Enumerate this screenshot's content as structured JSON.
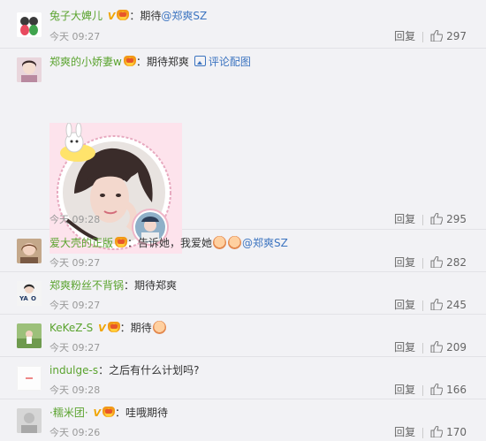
{
  "comments": [
    {
      "username": "兔子大婢儿",
      "vip": "V",
      "text": "期待",
      "mention": "@郑爽SZ",
      "time": "今天 09:27",
      "reply": "回复",
      "likes": "297"
    },
    {
      "username": "郑爽的小娇妻w",
      "text": "期待郑爽",
      "pic_link": "评论配图",
      "time": "今天 09:28",
      "reply": "回复",
      "likes": "295"
    },
    {
      "username": "爱大壳的正版",
      "text": "告诉她，我爱她",
      "mention": "@郑爽SZ",
      "time": "今天 09:27",
      "reply": "回复",
      "likes": "282"
    },
    {
      "username": "郑爽粉丝不背锅",
      "text": "期待郑爽",
      "time": "今天 09:27",
      "reply": "回复",
      "likes": "245"
    },
    {
      "username": "KeKeZ-S",
      "vip": "V",
      "text": "期待",
      "time": "今天 09:27",
      "reply": "回复",
      "likes": "209"
    },
    {
      "username": "indulge-s",
      "text": "之后有什么计划吗?",
      "time": "今天 09:28",
      "reply": "回复",
      "likes": "166"
    },
    {
      "username": "·糯米团·",
      "vip": "V",
      "text": "哇哦期待",
      "time": "今天 09:26",
      "reply": "回复",
      "likes": "170"
    }
  ],
  "colors": {
    "username": "#5aa32e",
    "mention": "#3c74c0",
    "vip": "#f0a400",
    "background": "#f2f2f5"
  }
}
